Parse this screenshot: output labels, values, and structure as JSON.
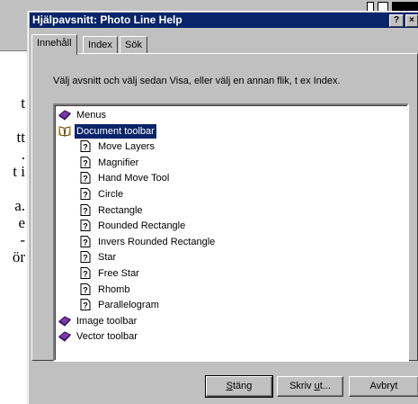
{
  "background": {
    "text_lines": [
      "t",
      "",
      "tt",
      ".",
      "t i",
      "",
      "a.",
      "e",
      "-",
      "ör"
    ]
  },
  "dialog": {
    "title": "Hjälpavsnitt: Photo Line Help",
    "help_button": "?",
    "close_button": "×"
  },
  "tabs": [
    {
      "label": "Innehåll",
      "active": true
    },
    {
      "label": "Index",
      "active": false
    },
    {
      "label": "Sök",
      "active": false
    }
  ],
  "instruction": "Välj avsnitt och välj sedan Visa, eller välj en annan flik, t ex Index.",
  "tree": {
    "items": [
      {
        "label": "Menus",
        "icon": "book-closed-icon",
        "level": 0
      },
      {
        "label": "Document toolbar",
        "icon": "book-open-icon",
        "level": 0,
        "selected": true
      },
      {
        "label": "Move Layers",
        "icon": "help-page-icon",
        "level": 1
      },
      {
        "label": "Magnifier",
        "icon": "help-page-icon",
        "level": 1
      },
      {
        "label": "Hand Move Tool",
        "icon": "help-page-icon",
        "level": 1
      },
      {
        "label": "Circle",
        "icon": "help-page-icon",
        "level": 1
      },
      {
        "label": "Rectangle",
        "icon": "help-page-icon",
        "level": 1
      },
      {
        "label": "Rounded Rectangle",
        "icon": "help-page-icon",
        "level": 1
      },
      {
        "label": "Invers Rounded Rectangle",
        "icon": "help-page-icon",
        "level": 1
      },
      {
        "label": "Star",
        "icon": "help-page-icon",
        "level": 1
      },
      {
        "label": "Free Star",
        "icon": "help-page-icon",
        "level": 1
      },
      {
        "label": "Rhomb",
        "icon": "help-page-icon",
        "level": 1
      },
      {
        "label": "Parallelogram",
        "icon": "help-page-icon",
        "level": 1
      },
      {
        "label": "Image toolbar",
        "icon": "book-closed-icon",
        "level": 0
      },
      {
        "label": "Vector toolbar",
        "icon": "book-closed-icon",
        "level": 0
      }
    ]
  },
  "buttons": {
    "close": {
      "pre": "",
      "ul": "S",
      "post": "täng"
    },
    "print": {
      "pre": "Skriv ",
      "ul": "u",
      "post": "t..."
    },
    "cancel": {
      "pre": "Avbryt",
      "ul": "",
      "post": ""
    }
  },
  "colors": {
    "titlebar": "#0a246a",
    "selection": "#0a246a",
    "face": "#c0c0c0"
  }
}
